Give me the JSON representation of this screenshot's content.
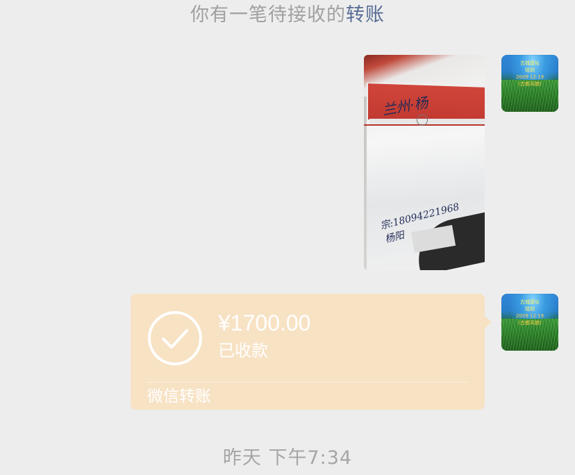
{
  "notice": {
    "text": "你有一笔待接收的",
    "link": "转账"
  },
  "avatar": {
    "line1": "古城遗址",
    "line2": "铭刻",
    "line3": "2009·12·19",
    "line4": "(古都风貌)"
  },
  "photo": {
    "handwriting_top": "兰州·杨",
    "handwriting_bottom1": "宗:18094221968",
    "handwriting_bottom2": "杨阳"
  },
  "transfer": {
    "amount": "¥1700.00",
    "status": "已收款",
    "footer_label": "微信转账"
  },
  "timestamp": "昨天 下午7:34",
  "colors": {
    "background": "#ededed",
    "transfer_bubble": "#f7e2c4",
    "notice_link": "#576b95",
    "muted_text": "#a0a0a0"
  },
  "icons": {
    "check": "check-circle-icon"
  }
}
